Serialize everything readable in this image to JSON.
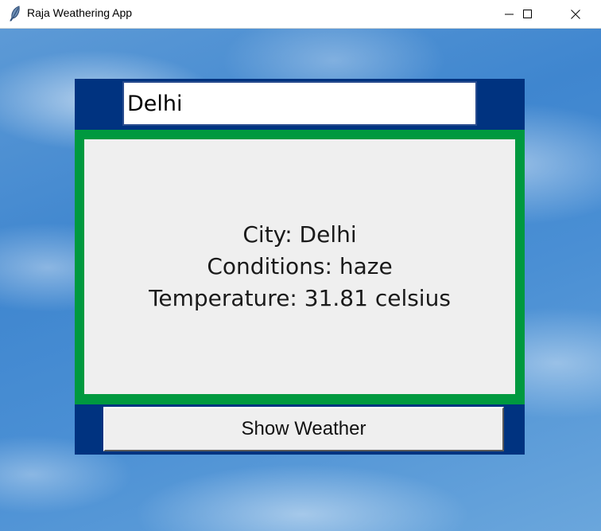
{
  "window": {
    "title": "Raja Weathering App",
    "icon": "feather-icon",
    "controls": [
      "minimize-icon",
      "maximize-icon",
      "close-icon"
    ]
  },
  "search": {
    "value": "Delhi"
  },
  "result": {
    "city_line": "City: Delhi",
    "conditions_line": "Conditions: haze",
    "temperature_line": "Temperature: 31.81 celsius"
  },
  "actions": {
    "show_weather_label": "Show Weather"
  },
  "colors": {
    "frame_navy": "#003380",
    "result_border_green": "#00993f",
    "panel_gray": "#efefef",
    "sky_blue": "#4a8fd4"
  }
}
